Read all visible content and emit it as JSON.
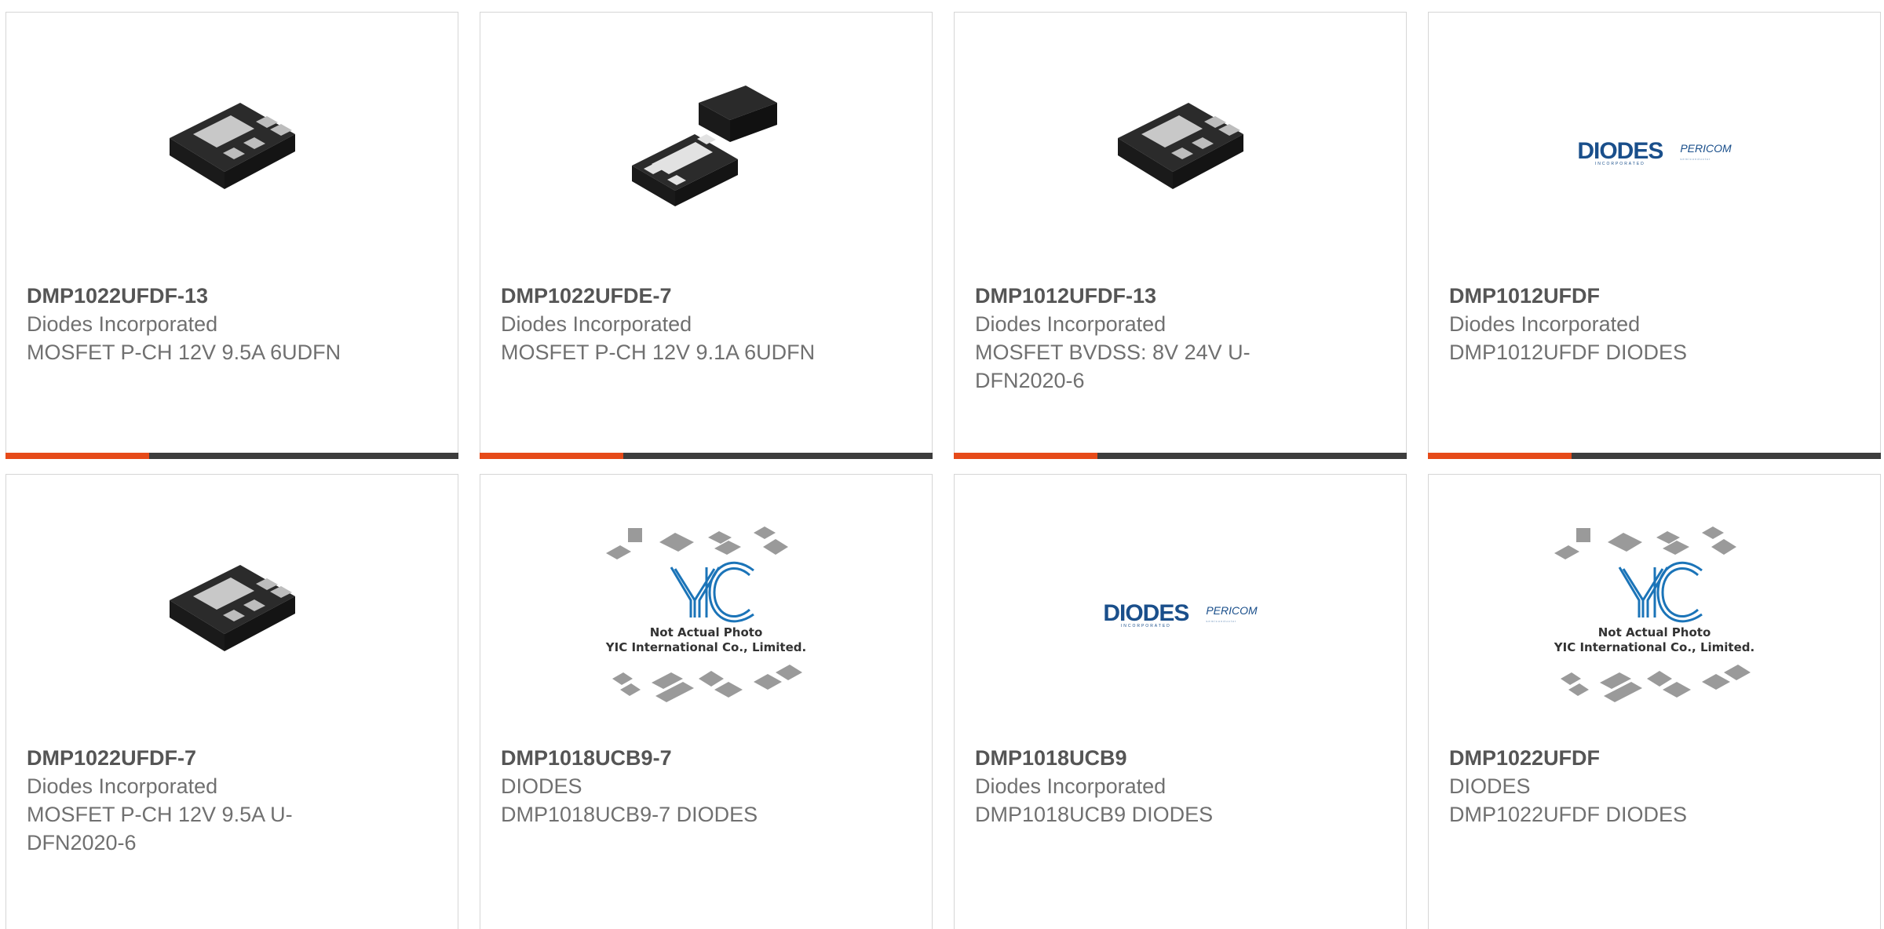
{
  "products": [
    {
      "part": "DMP1022UFDF-13",
      "manufacturer": "Diodes Incorporated",
      "description": "MOSFET P-CH 12V 9.5A 6UDFN",
      "image": "chip-6pin-icon"
    },
    {
      "part": "DMP1022UFDE-7",
      "manufacturer": "Diodes Incorporated",
      "description": "MOSFET P-CH 12V 9.1A 6UDFN",
      "image": "chip-pair-icon"
    },
    {
      "part": "DMP1012UFDF-13",
      "manufacturer": "Diodes Incorporated",
      "description": "MOSFET BVDSS: 8V 24V U-DFN2020-6",
      "image": "chip-6pin-icon"
    },
    {
      "part": "DMP1012UFDF",
      "manufacturer": "Diodes Incorporated",
      "description": "DMP1012UFDF DIODES",
      "image": "diodes-pericom-logo"
    },
    {
      "part": "DMP1022UFDF-7",
      "manufacturer": "Diodes Incorporated",
      "description": "MOSFET P-CH 12V 9.5A U-DFN2020-6",
      "image": "chip-6pin-icon"
    },
    {
      "part": "DMP1018UCB9-7",
      "manufacturer": "DIODES",
      "description": "DMP1018UCB9-7 DIODES",
      "image": "not-actual-photo-placeholder"
    },
    {
      "part": "DMP1018UCB9",
      "manufacturer": "Diodes Incorporated",
      "description": "DMP1018UCB9 DIODES",
      "image": "diodes-pericom-logo"
    },
    {
      "part": "DMP1022UFDF",
      "manufacturer": "DIODES",
      "description": "DMP1022UFDF DIODES",
      "image": "not-actual-photo-placeholder"
    }
  ],
  "logo": {
    "brand": "DIODES",
    "brand_sub": "INCORPORATED",
    "partner": "PERICOM",
    "partner_tag": "semiconductor"
  },
  "placeholder": {
    "line1": "Not Actual Photo",
    "line2": "YIC International Co., Limited.",
    "mark": "YIC"
  },
  "colors": {
    "accent": "#e64a19",
    "bar": "#3d3d3d",
    "part_text": "#555555",
    "body_text": "#707070",
    "border": "#d6d6d6"
  }
}
